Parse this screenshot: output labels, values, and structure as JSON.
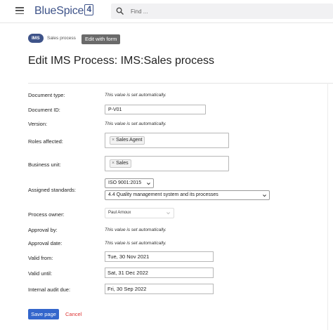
{
  "header": {
    "logo_text": "BlueSpice",
    "logo_digit": "4",
    "search_placeholder": "Find ..."
  },
  "breadcrumb": {
    "namespace": "IMS",
    "page": "Sales process",
    "action": "Edit with form"
  },
  "page_title": "Edit IMS Process: IMS:Sales process",
  "form": {
    "auto_text": "This value is set automatically.",
    "document_type": {
      "label": "Document type:"
    },
    "document_id": {
      "label": "Document ID:",
      "value": "P-V01"
    },
    "version": {
      "label": "Version:"
    },
    "roles_affected": {
      "label": "Roles affected:",
      "tag": "Sales Agent"
    },
    "business_unit": {
      "label": "Business unit:",
      "tag": "Sales"
    },
    "assigned_standards": {
      "label": "Assigned standards:",
      "standard": "ISO 9001:2015",
      "clause": "4.4 Quality management system and its processes"
    },
    "process_owner": {
      "label": "Process owner:",
      "value": "Paul Arnoux"
    },
    "approval_by": {
      "label": "Approval by:"
    },
    "approval_date": {
      "label": "Approval date:"
    },
    "valid_from": {
      "label": "Valid from:",
      "value": "Tue, 30 Nov 2021"
    },
    "valid_until": {
      "label": "Valid until:",
      "value": "Sat, 31 Dec 2022"
    },
    "internal_audit_due": {
      "label": "Internal audit due:",
      "value": "Fri, 30 Sep 2022"
    },
    "tag_remove": "×"
  },
  "actions": {
    "save": "Save page",
    "cancel": "Cancel"
  },
  "colors": {
    "brand": "#3e5389",
    "primary_button": "#3366cc",
    "cancel_link": "#dd3333"
  },
  "icons": {
    "menu": "hamburger-icon",
    "search": "search-icon",
    "caret": "chevron-down-icon",
    "remove": "close-icon"
  }
}
